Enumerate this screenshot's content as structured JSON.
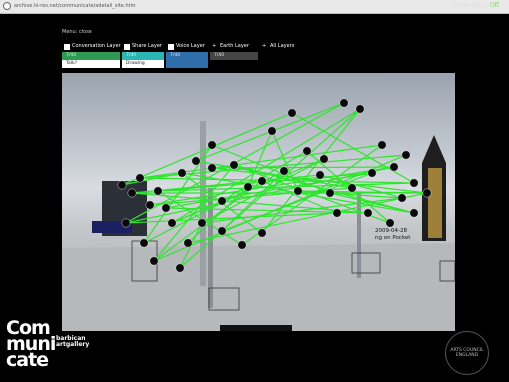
{
  "browser": {
    "url": "archive.hi-res.net/communicate/adetail_site.htm"
  },
  "header": {
    "truncation_label": "Truncation:",
    "truncation_value": "Off"
  },
  "menu": {
    "title": "Menu: close",
    "layers": [
      {
        "label": "Conversation Layer",
        "color": "#2e9a52",
        "sub": [
          "7/40",
          "Talk?"
        ]
      },
      {
        "label": "Share Layer",
        "color": "#2ab7b3",
        "sub": [
          "7/40",
          "Drawing"
        ]
      },
      {
        "label": "Voice Layer",
        "color": "#2f6ea8",
        "sub": [
          "7/40",
          ""
        ]
      },
      {
        "label": "Earth Layer",
        "color": "#444444",
        "sub": [
          "7/40",
          ""
        ]
      },
      {
        "label": "All Layers",
        "color": "#000000",
        "sub": []
      }
    ]
  },
  "scene": {
    "annotation_line1": "2009-04-28",
    "annotation_line2": "ng on Pocket"
  },
  "branding": {
    "logo": [
      "Com",
      "muni",
      "cate"
    ],
    "logo_sub": [
      "barbican",
      "artgallery"
    ],
    "council": "ARTS COUNCIL ENGLAND"
  },
  "colors": {
    "link_green": "#2ee52e",
    "node_black": "#0a0a0a"
  }
}
